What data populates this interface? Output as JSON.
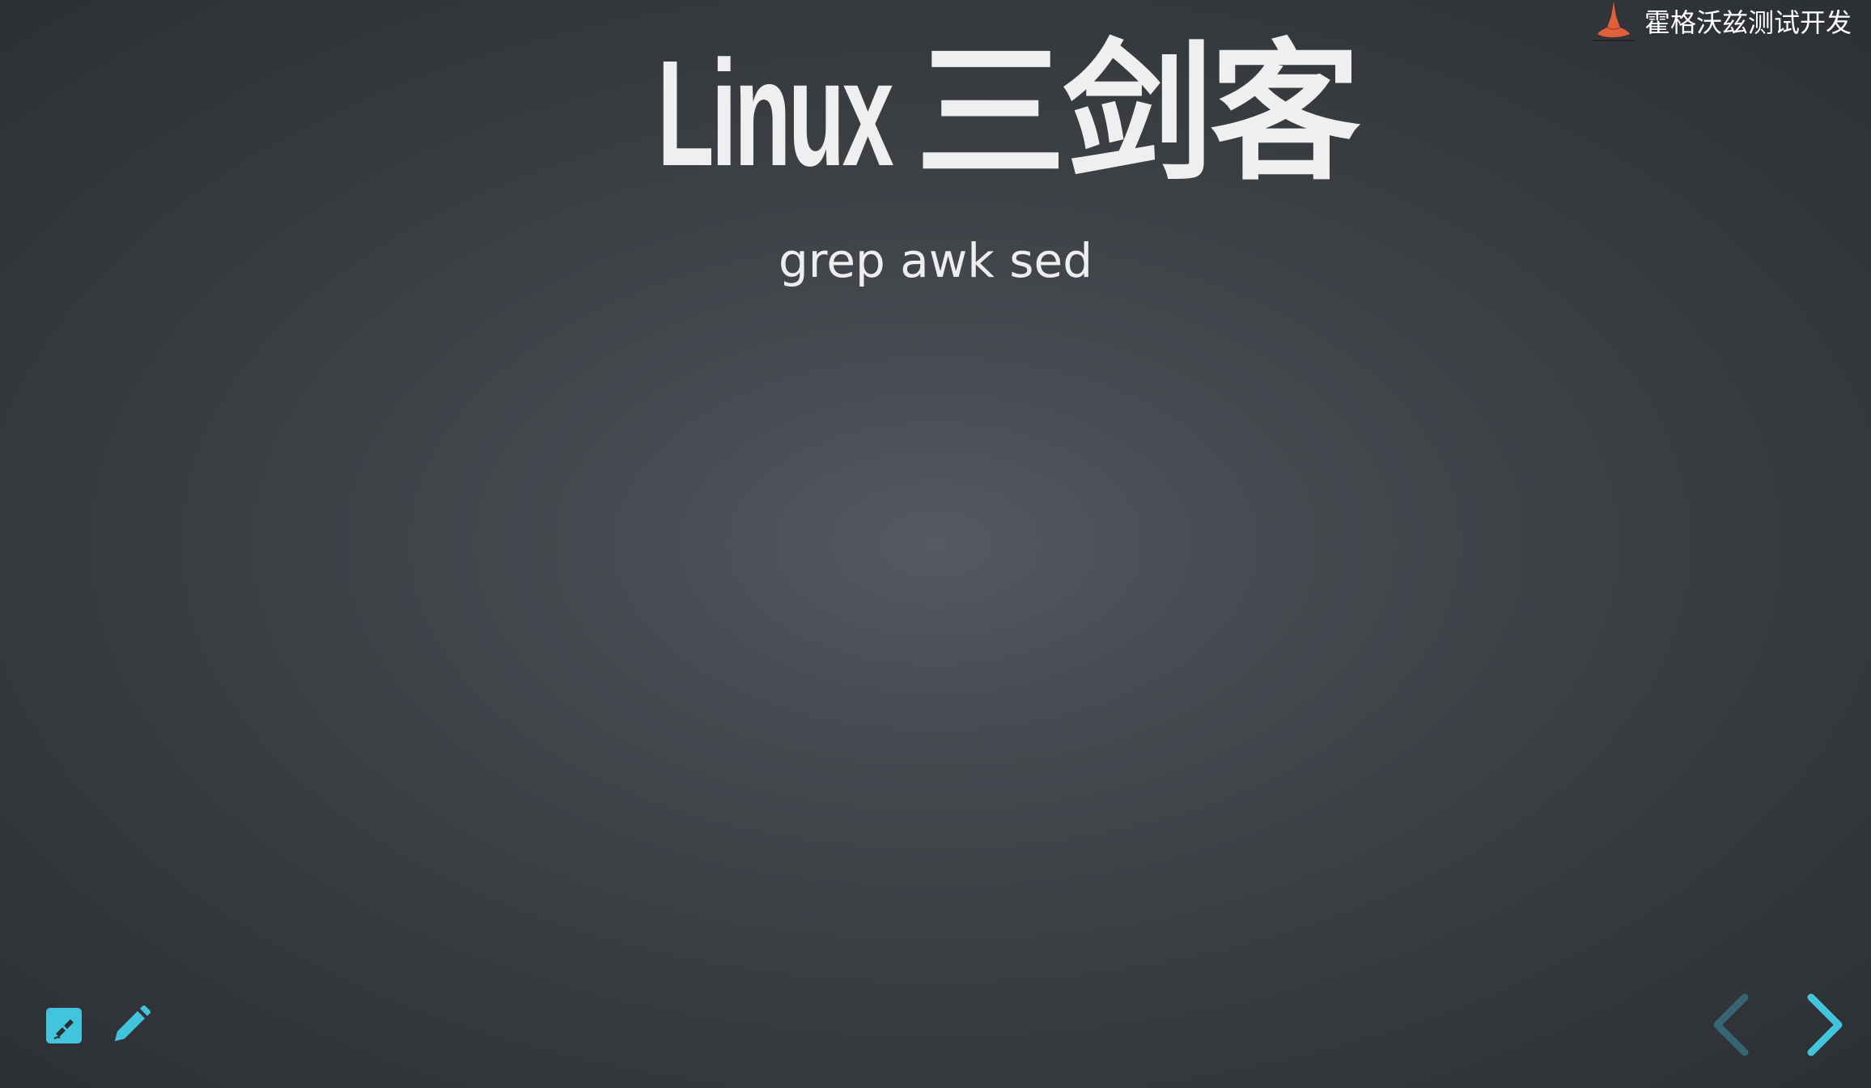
{
  "slide": {
    "title_latin": "Linux",
    "title_cjk": "三剑客",
    "subtitle": "grep awk sed"
  },
  "brand": {
    "name": "霍格沃兹测试开发",
    "logo_icon": "wizard-hat-icon",
    "accent": "#e0603a"
  },
  "controls": {
    "chalkboard_icon": "chalkboard-icon",
    "pen_icon": "pen-icon",
    "prev_icon": "chevron-left-icon",
    "next_icon": "chevron-right-icon",
    "accent": "#42c4dd"
  }
}
